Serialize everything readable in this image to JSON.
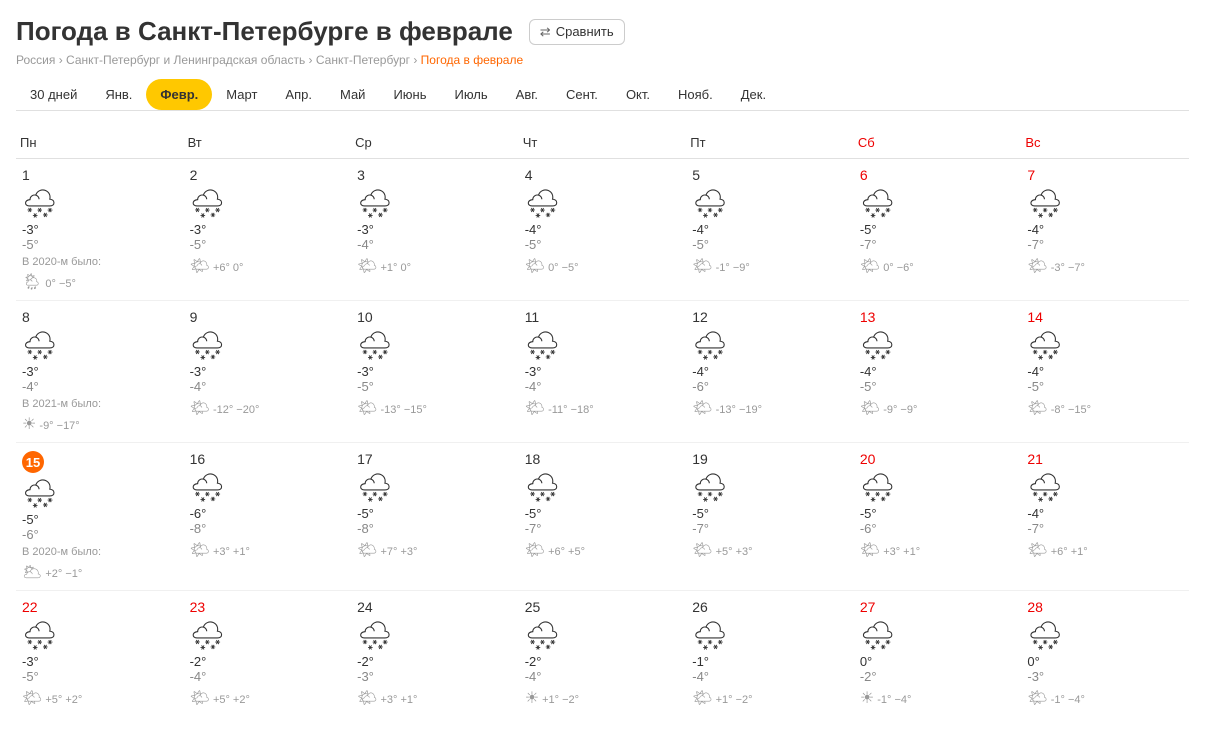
{
  "title": "Погода в Санкт-Петербурге в феврале",
  "compareBtn": "Сравнить",
  "breadcrumb": {
    "items": [
      "Россия",
      "Санкт-Петербург и Ленинградская область",
      "Санкт-Петербург"
    ],
    "current": "Погода в феврале"
  },
  "tabs": [
    {
      "label": "30 дней",
      "active": false
    },
    {
      "label": "Янв.",
      "active": false
    },
    {
      "label": "Февр.",
      "active": true
    },
    {
      "label": "Март",
      "active": false
    },
    {
      "label": "Апр.",
      "active": false
    },
    {
      "label": "Май",
      "active": false
    },
    {
      "label": "Июнь",
      "active": false
    },
    {
      "label": "Июль",
      "active": false
    },
    {
      "label": "Авг.",
      "active": false
    },
    {
      "label": "Сент.",
      "active": false
    },
    {
      "label": "Окт.",
      "active": false
    },
    {
      "label": "Нояб.",
      "active": false
    },
    {
      "label": "Дек.",
      "active": false
    }
  ],
  "weekdays": [
    "Пн",
    "Вт",
    "Ср",
    "Чт",
    "Пт",
    "Сб",
    "Вс"
  ],
  "weeks": [
    {
      "days": [
        {
          "num": "1",
          "hi": "-3°",
          "lo": "-5°",
          "icon": "🌨",
          "prevLabel": "В 2020-м было:",
          "prevIcon": "🌦",
          "prevTemps": "0° −5°"
        },
        {
          "num": "2",
          "hi": "-3°",
          "lo": "-5°",
          "icon": "🌨",
          "prevLabel": "",
          "prevIcon": "🌤",
          "prevTemps": "+6° 0°"
        },
        {
          "num": "3",
          "hi": "-3°",
          "lo": "-4°",
          "icon": "🌨",
          "prevLabel": "",
          "prevIcon": "🌤",
          "prevTemps": "+1° 0°"
        },
        {
          "num": "4",
          "hi": "-4°",
          "lo": "-5°",
          "icon": "🌨",
          "prevLabel": "",
          "prevIcon": "🌤",
          "prevTemps": "0° −5°"
        },
        {
          "num": "5",
          "hi": "-4°",
          "lo": "-5°",
          "icon": "🌨",
          "prevLabel": "",
          "prevIcon": "🌤",
          "prevTemps": "-1° −9°"
        },
        {
          "num": "6",
          "hi": "-5°",
          "lo": "-7°",
          "icon": "🌨",
          "prevLabel": "",
          "prevIcon": "🌤",
          "prevTemps": "0° −6°",
          "weekend": true
        },
        {
          "num": "7",
          "hi": "-4°",
          "lo": "-7°",
          "icon": "🌨",
          "prevLabel": "",
          "prevIcon": "🌤",
          "prevTemps": "-3° −7°",
          "weekend": true
        }
      ]
    },
    {
      "days": [
        {
          "num": "8",
          "hi": "-3°",
          "lo": "-4°",
          "icon": "🌨",
          "prevLabel": "В 2021-м было:",
          "prevIcon": "☀",
          "prevTemps": "-9° −17°"
        },
        {
          "num": "9",
          "hi": "-3°",
          "lo": "-4°",
          "icon": "🌨",
          "prevLabel": "",
          "prevIcon": "🌤",
          "prevTemps": "-12° −20°"
        },
        {
          "num": "10",
          "hi": "-3°",
          "lo": "-5°",
          "icon": "🌨",
          "prevLabel": "",
          "prevIcon": "🌤",
          "prevTemps": "-13° −15°"
        },
        {
          "num": "11",
          "hi": "-3°",
          "lo": "-4°",
          "icon": "🌨",
          "prevLabel": "",
          "prevIcon": "🌤",
          "prevTemps": "-11° −18°"
        },
        {
          "num": "12",
          "hi": "-4°",
          "lo": "-6°",
          "icon": "🌨",
          "prevLabel": "",
          "prevIcon": "🌤",
          "prevTemps": "-13° −19°"
        },
        {
          "num": "13",
          "hi": "-4°",
          "lo": "-5°",
          "icon": "🌨",
          "prevLabel": "",
          "prevIcon": "🌤",
          "prevTemps": "-9° −9°",
          "weekend": true
        },
        {
          "num": "14",
          "hi": "-4°",
          "lo": "-5°",
          "icon": "🌨",
          "prevLabel": "",
          "prevIcon": "🌤",
          "prevTemps": "-8° −15°",
          "weekend": true
        }
      ]
    },
    {
      "days": [
        {
          "num": "15",
          "hi": "-5°",
          "lo": "-6°",
          "icon": "🌨",
          "prevLabel": "В 2020-м было:",
          "prevIcon": "🌥",
          "prevTemps": "+2° −1°",
          "today": true
        },
        {
          "num": "16",
          "hi": "-6°",
          "lo": "-8°",
          "icon": "🌨",
          "prevLabel": "",
          "prevIcon": "🌤",
          "prevTemps": "+3° +1°"
        },
        {
          "num": "17",
          "hi": "-5°",
          "lo": "-8°",
          "icon": "🌨",
          "prevLabel": "",
          "prevIcon": "🌤",
          "prevTemps": "+7° +3°"
        },
        {
          "num": "18",
          "hi": "-5°",
          "lo": "-7°",
          "icon": "🌨",
          "prevLabel": "",
          "prevIcon": "🌤",
          "prevTemps": "+6° +5°"
        },
        {
          "num": "19",
          "hi": "-5°",
          "lo": "-7°",
          "icon": "🌨",
          "prevLabel": "",
          "prevIcon": "🌤",
          "prevTemps": "+5° +3°"
        },
        {
          "num": "20",
          "hi": "-5°",
          "lo": "-6°",
          "icon": "🌨",
          "prevLabel": "",
          "prevIcon": "🌤",
          "prevTemps": "+3° +1°",
          "weekend": true
        },
        {
          "num": "21",
          "hi": "-4°",
          "lo": "-7°",
          "icon": "🌨",
          "prevLabel": "",
          "prevIcon": "🌤",
          "prevTemps": "+6° +1°",
          "weekend": true
        }
      ]
    },
    {
      "days": [
        {
          "num": "22",
          "hi": "-3°",
          "lo": "-5°",
          "icon": "🌨",
          "prevLabel": "",
          "prevIcon": "🌤",
          "prevTemps": "+5° +2°",
          "weekend": true,
          "weekendNum": true
        },
        {
          "num": "23",
          "hi": "-2°",
          "lo": "-4°",
          "icon": "🌨",
          "prevLabel": "",
          "prevIcon": "🌤",
          "prevTemps": "+5° +2°",
          "weekend": true,
          "weekendNum": true
        },
        {
          "num": "24",
          "hi": "-2°",
          "lo": "-3°",
          "icon": "🌨",
          "prevLabel": "",
          "prevIcon": "🌤",
          "prevTemps": "+3° +1°"
        },
        {
          "num": "25",
          "hi": "-2°",
          "lo": "-4°",
          "icon": "🌨",
          "prevLabel": "",
          "prevIcon": "☀",
          "prevTemps": "+1° −2°"
        },
        {
          "num": "26",
          "hi": "-1°",
          "lo": "-4°",
          "icon": "🌨",
          "prevLabel": "",
          "prevIcon": "🌤",
          "prevTemps": "+1° −2°"
        },
        {
          "num": "27",
          "hi": "0°",
          "lo": "-2°",
          "icon": "🌨",
          "prevLabel": "",
          "prevIcon": "☀",
          "prevTemps": "-1° −4°",
          "weekend": true
        },
        {
          "num": "28",
          "hi": "0°",
          "lo": "-3°",
          "icon": "🌨",
          "prevLabel": "",
          "prevIcon": "🌤",
          "prevTemps": "-1° −4°",
          "weekend": true
        }
      ]
    }
  ]
}
